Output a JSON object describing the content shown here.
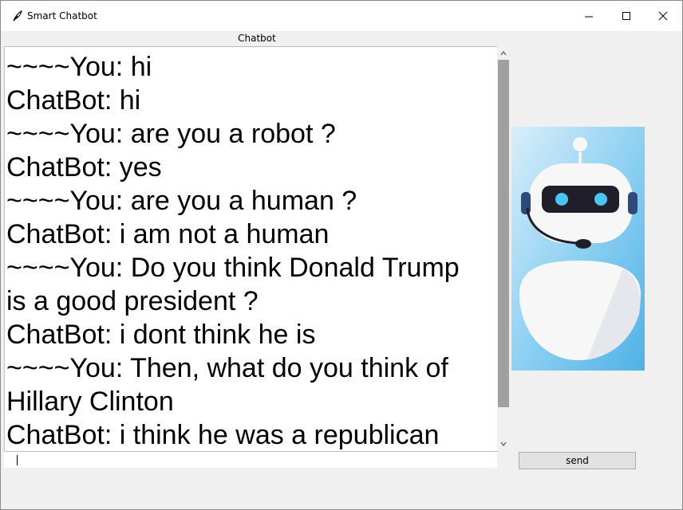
{
  "window": {
    "title": "Smart Chatbot",
    "icon": "feather-icon",
    "controls": [
      "minimize-icon",
      "maximize-icon",
      "close-icon"
    ]
  },
  "chat": {
    "frame_label": "Chatbot",
    "lines": [
      "~~~~You: hi",
      "ChatBot:  hi",
      "~~~~You: are you a robot ?",
      "ChatBot:  yes",
      "~~~~You: are you a human ?",
      "ChatBot:  i am not a human",
      "~~~~You: Do you think Donald Trump",
      "is a good president ?",
      "ChatBot:  i dont think he is",
      "~~~~You: Then, what do you think of",
      "Hillary Clinton",
      "ChatBot:  i think he was a republican"
    ]
  },
  "input": {
    "value": ""
  },
  "send_button": {
    "label": "send"
  },
  "image": {
    "subject": "robot-illustration"
  },
  "colors": {
    "titlebar": "#ffffff",
    "window_bg": "#f0f0f0",
    "scroll_thumb": "#a0a0a0",
    "robot_eyes": "#4cc3f5"
  }
}
